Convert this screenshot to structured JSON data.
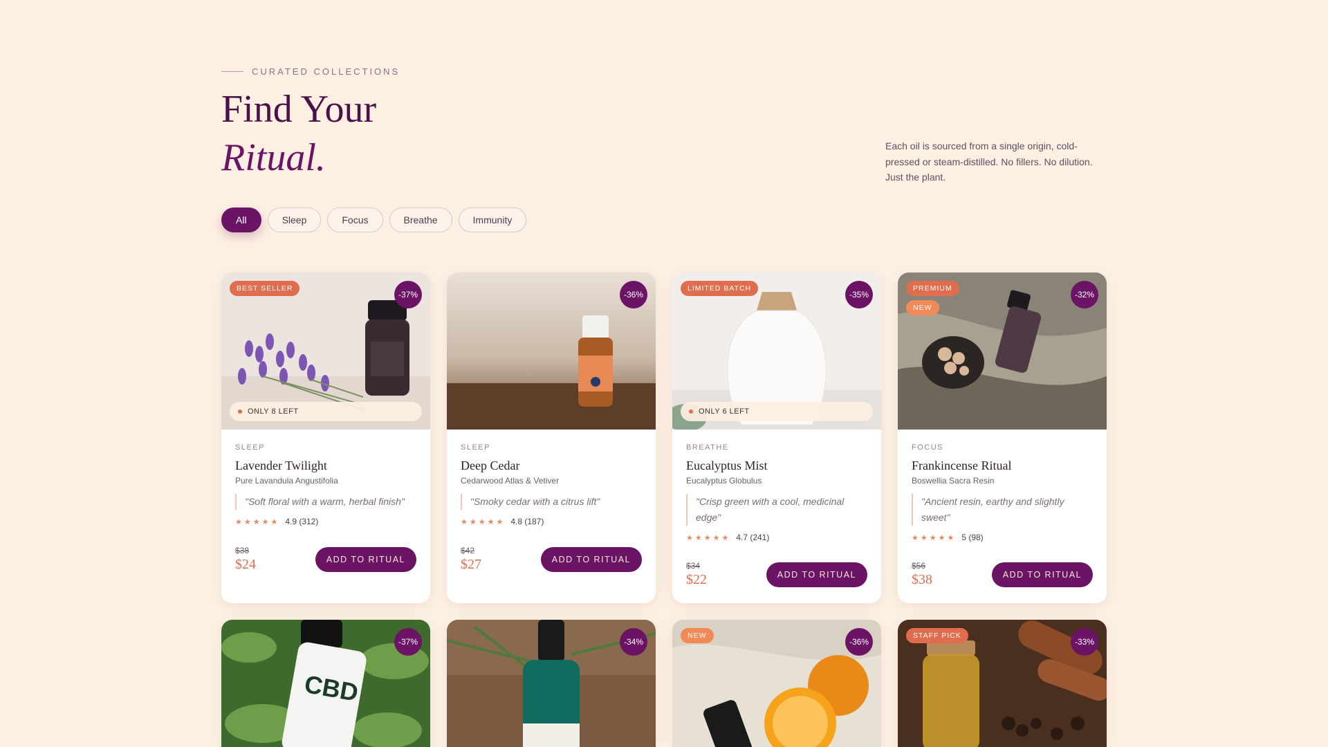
{
  "header": {
    "eyebrow": "CURATED COLLECTIONS",
    "title_line1": "Find Your",
    "title_line2": "Ritual.",
    "intro": "Each oil is sourced from a single origin, cold-pressed or steam-distilled. No fillers. No dilution. Just the plant."
  },
  "filters": [
    "All",
    "Sleep",
    "Focus",
    "Breathe",
    "Immunity"
  ],
  "active_filter": "All",
  "colors": {
    "accent": "#6b1465",
    "coral": "#e06d4e",
    "background": "#fdf0e2"
  },
  "cta_label": "ADD TO RITUAL",
  "products": [
    {
      "badges": [
        "BEST SELLER"
      ],
      "discount": "-37%",
      "stock": "ONLY 8 LEFT",
      "category": "SLEEP",
      "name": "Lavender Twilight",
      "latin": "Pure Lavandula Angustifolia",
      "quote": "\"Soft floral with a warm, herbal finish\"",
      "rating": "4.9 (312)",
      "old_price": "$38",
      "price": "$24",
      "image": "lavender-bottle"
    },
    {
      "badges": [],
      "discount": "-36%",
      "stock": "",
      "category": "SLEEP",
      "name": "Deep Cedar",
      "latin": "Cedarwood Atlas & Vetiver",
      "quote": "\"Smoky cedar with a citrus lift\"",
      "rating": "4.8 (187)",
      "old_price": "$42",
      "price": "$27",
      "image": "cedar-bottle"
    },
    {
      "badges": [
        "LIMITED BATCH"
      ],
      "discount": "-35%",
      "stock": "ONLY 6 LEFT",
      "category": "BREATHE",
      "name": "Eucalyptus Mist",
      "latin": "Eucalyptus Globulus",
      "quote": "\"Crisp green with a cool, medicinal edge\"",
      "rating": "4.7 (241)",
      "old_price": "$34",
      "price": "$22",
      "image": "diffuser"
    },
    {
      "badges": [
        "PREMIUM",
        "NEW"
      ],
      "discount": "-32%",
      "stock": "",
      "category": "FOCUS",
      "name": "Frankincense Ritual",
      "latin": "Boswellia Sacra Resin",
      "quote": "\"Ancient resin, earthy and slightly sweet\"",
      "rating": "5 (98)",
      "old_price": "$56",
      "price": "$38",
      "image": "frankincense"
    }
  ],
  "row2": [
    {
      "badges": [],
      "discount": "-37%",
      "image": "mint-cbd"
    },
    {
      "badges": [],
      "discount": "-34%",
      "image": "tea-tree"
    },
    {
      "badges": [
        "NEW"
      ],
      "discount": "-36%",
      "image": "orange"
    },
    {
      "badges": [
        "STAFF PICK"
      ],
      "discount": "-33%",
      "image": "clove-cinnamon"
    }
  ]
}
